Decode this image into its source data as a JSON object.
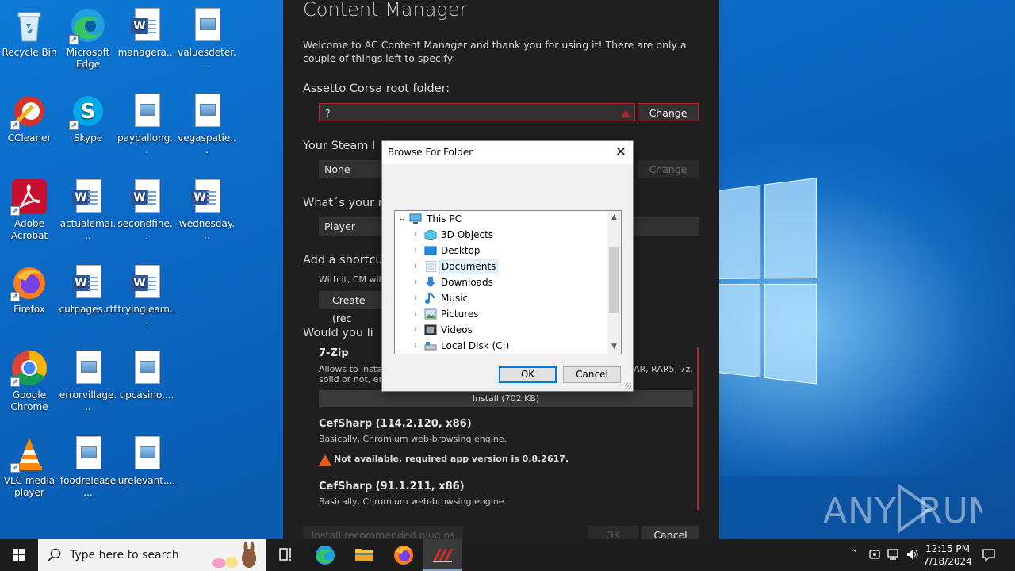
{
  "desktop": {
    "icons": [
      {
        "label": "Recycle Bin",
        "type": "recycle"
      },
      {
        "label": "Microsoft Edge",
        "type": "edge"
      },
      {
        "label": "managera...",
        "type": "word"
      },
      {
        "label": "valuesdeter...",
        "type": "image"
      },
      {
        "label": "CCleaner",
        "type": "ccleaner"
      },
      {
        "label": "Skype",
        "type": "skype"
      },
      {
        "label": "paypallong...",
        "type": "image"
      },
      {
        "label": "vegaspatie...",
        "type": "image"
      },
      {
        "label": "Adobe Acrobat",
        "type": "acrobat"
      },
      {
        "label": "actualemai...",
        "type": "word"
      },
      {
        "label": "secondfine...",
        "type": "word"
      },
      {
        "label": "wednesday...",
        "type": "word"
      },
      {
        "label": "Firefox",
        "type": "firefox"
      },
      {
        "label": "cutpages.rtf",
        "type": "word"
      },
      {
        "label": "tryinglearn...",
        "type": "word"
      },
      {
        "label": "Google Chrome",
        "type": "chrome"
      },
      {
        "label": "errorvillage...",
        "type": "image"
      },
      {
        "label": "upcasino....",
        "type": "image"
      },
      {
        "label": "VLC media player",
        "type": "vlc"
      },
      {
        "label": "foodrelease...",
        "type": "image"
      },
      {
        "label": "urelevant....",
        "type": "image"
      }
    ]
  },
  "content_manager": {
    "title": "Content Manager",
    "intro": "Welcome to AC Content Manager and thank you for using it! There are only a couple of things left to specify:",
    "root_heading": "Assetto Corsa root folder:",
    "root_value": "?",
    "change_label": "Change",
    "steam_heading": "Your Steam I",
    "steam_value": "None",
    "steam_change": "Change",
    "name_heading": "What´s your n",
    "name_value": "Player",
    "shortcut_heading": "Add a shortcu",
    "shortcut_desc": "With it, CM will",
    "shortcut_button": "Create (rec",
    "plugins_heading": "Would you li",
    "plugins": [
      {
        "name": "7-Zip",
        "desc": "Allows to instal",
        "desc2": "solid or not, en",
        "desc_right": "AR, RAR5, 7z,",
        "install": "Install (702 KB)"
      },
      {
        "name": "CefSharp (114.2.120, x86)",
        "desc": "Basically, Chromium web-browsing engine.",
        "warning": "Not available, required app version is 0.8.2617."
      },
      {
        "name": "CefSharp (91.1.211, x86)",
        "desc": "Basically, Chromium web-browsing engine."
      }
    ],
    "install_recommended": "Install recommended plugins",
    "ok_label": "OK",
    "cancel_label": "Cancel"
  },
  "dialog": {
    "title": "Browse For Folder",
    "tree": [
      {
        "label": "This PC",
        "icon": "pc-icon",
        "expanded": true
      },
      {
        "label": "3D Objects",
        "icon": "3d-objects-icon"
      },
      {
        "label": "Desktop",
        "icon": "desktop-icon"
      },
      {
        "label": "Documents",
        "icon": "documents-icon",
        "selected": true
      },
      {
        "label": "Downloads",
        "icon": "downloads-icon"
      },
      {
        "label": "Music",
        "icon": "music-icon"
      },
      {
        "label": "Pictures",
        "icon": "pictures-icon"
      },
      {
        "label": "Videos",
        "icon": "videos-icon"
      },
      {
        "label": "Local Disk (C:)",
        "icon": "local-disk-icon"
      }
    ],
    "ok_label": "OK",
    "cancel_label": "Cancel"
  },
  "taskbar": {
    "search_placeholder": "Type here to search",
    "time": "12:15 PM",
    "date": "7/18/2024"
  },
  "watermark": "ANY RUN",
  "colors": {
    "desktop_blue": "#0b67c3",
    "cm_background": "#1f1f1f",
    "error_red": "#b8232a",
    "warning_orange": "#e8581c",
    "focus_blue": "#0078d7"
  }
}
